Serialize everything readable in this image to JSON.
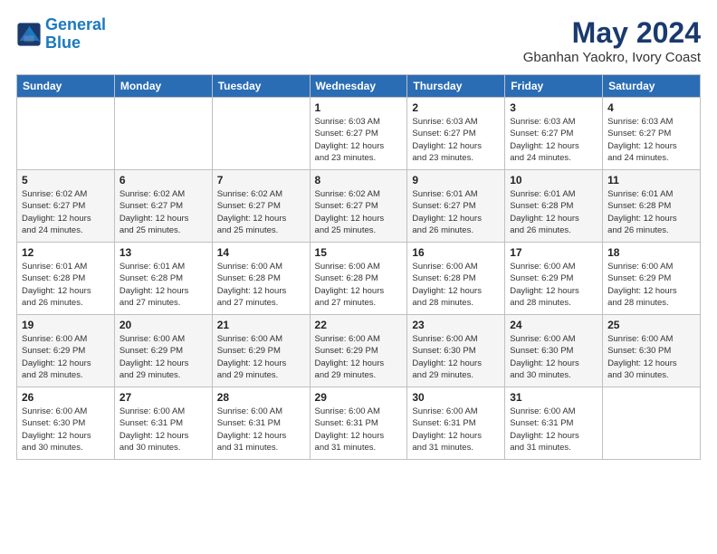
{
  "logo": {
    "line1": "General",
    "line2": "Blue"
  },
  "title": "May 2024",
  "subtitle": "Gbanhan Yaokro, Ivory Coast",
  "weekdays": [
    "Sunday",
    "Monday",
    "Tuesday",
    "Wednesday",
    "Thursday",
    "Friday",
    "Saturday"
  ],
  "weeks": [
    [
      {
        "day": "",
        "info": ""
      },
      {
        "day": "",
        "info": ""
      },
      {
        "day": "",
        "info": ""
      },
      {
        "day": "1",
        "info": "Sunrise: 6:03 AM\nSunset: 6:27 PM\nDaylight: 12 hours\nand 23 minutes."
      },
      {
        "day": "2",
        "info": "Sunrise: 6:03 AM\nSunset: 6:27 PM\nDaylight: 12 hours\nand 23 minutes."
      },
      {
        "day": "3",
        "info": "Sunrise: 6:03 AM\nSunset: 6:27 PM\nDaylight: 12 hours\nand 24 minutes."
      },
      {
        "day": "4",
        "info": "Sunrise: 6:03 AM\nSunset: 6:27 PM\nDaylight: 12 hours\nand 24 minutes."
      }
    ],
    [
      {
        "day": "5",
        "info": "Sunrise: 6:02 AM\nSunset: 6:27 PM\nDaylight: 12 hours\nand 24 minutes."
      },
      {
        "day": "6",
        "info": "Sunrise: 6:02 AM\nSunset: 6:27 PM\nDaylight: 12 hours\nand 25 minutes."
      },
      {
        "day": "7",
        "info": "Sunrise: 6:02 AM\nSunset: 6:27 PM\nDaylight: 12 hours\nand 25 minutes."
      },
      {
        "day": "8",
        "info": "Sunrise: 6:02 AM\nSunset: 6:27 PM\nDaylight: 12 hours\nand 25 minutes."
      },
      {
        "day": "9",
        "info": "Sunrise: 6:01 AM\nSunset: 6:27 PM\nDaylight: 12 hours\nand 26 minutes."
      },
      {
        "day": "10",
        "info": "Sunrise: 6:01 AM\nSunset: 6:28 PM\nDaylight: 12 hours\nand 26 minutes."
      },
      {
        "day": "11",
        "info": "Sunrise: 6:01 AM\nSunset: 6:28 PM\nDaylight: 12 hours\nand 26 minutes."
      }
    ],
    [
      {
        "day": "12",
        "info": "Sunrise: 6:01 AM\nSunset: 6:28 PM\nDaylight: 12 hours\nand 26 minutes."
      },
      {
        "day": "13",
        "info": "Sunrise: 6:01 AM\nSunset: 6:28 PM\nDaylight: 12 hours\nand 27 minutes."
      },
      {
        "day": "14",
        "info": "Sunrise: 6:00 AM\nSunset: 6:28 PM\nDaylight: 12 hours\nand 27 minutes."
      },
      {
        "day": "15",
        "info": "Sunrise: 6:00 AM\nSunset: 6:28 PM\nDaylight: 12 hours\nand 27 minutes."
      },
      {
        "day": "16",
        "info": "Sunrise: 6:00 AM\nSunset: 6:28 PM\nDaylight: 12 hours\nand 28 minutes."
      },
      {
        "day": "17",
        "info": "Sunrise: 6:00 AM\nSunset: 6:29 PM\nDaylight: 12 hours\nand 28 minutes."
      },
      {
        "day": "18",
        "info": "Sunrise: 6:00 AM\nSunset: 6:29 PM\nDaylight: 12 hours\nand 28 minutes."
      }
    ],
    [
      {
        "day": "19",
        "info": "Sunrise: 6:00 AM\nSunset: 6:29 PM\nDaylight: 12 hours\nand 28 minutes."
      },
      {
        "day": "20",
        "info": "Sunrise: 6:00 AM\nSunset: 6:29 PM\nDaylight: 12 hours\nand 29 minutes."
      },
      {
        "day": "21",
        "info": "Sunrise: 6:00 AM\nSunset: 6:29 PM\nDaylight: 12 hours\nand 29 minutes."
      },
      {
        "day": "22",
        "info": "Sunrise: 6:00 AM\nSunset: 6:29 PM\nDaylight: 12 hours\nand 29 minutes."
      },
      {
        "day": "23",
        "info": "Sunrise: 6:00 AM\nSunset: 6:30 PM\nDaylight: 12 hours\nand 29 minutes."
      },
      {
        "day": "24",
        "info": "Sunrise: 6:00 AM\nSunset: 6:30 PM\nDaylight: 12 hours\nand 30 minutes."
      },
      {
        "day": "25",
        "info": "Sunrise: 6:00 AM\nSunset: 6:30 PM\nDaylight: 12 hours\nand 30 minutes."
      }
    ],
    [
      {
        "day": "26",
        "info": "Sunrise: 6:00 AM\nSunset: 6:30 PM\nDaylight: 12 hours\nand 30 minutes."
      },
      {
        "day": "27",
        "info": "Sunrise: 6:00 AM\nSunset: 6:31 PM\nDaylight: 12 hours\nand 30 minutes."
      },
      {
        "day": "28",
        "info": "Sunrise: 6:00 AM\nSunset: 6:31 PM\nDaylight: 12 hours\nand 31 minutes."
      },
      {
        "day": "29",
        "info": "Sunrise: 6:00 AM\nSunset: 6:31 PM\nDaylight: 12 hours\nand 31 minutes."
      },
      {
        "day": "30",
        "info": "Sunrise: 6:00 AM\nSunset: 6:31 PM\nDaylight: 12 hours\nand 31 minutes."
      },
      {
        "day": "31",
        "info": "Sunrise: 6:00 AM\nSunset: 6:31 PM\nDaylight: 12 hours\nand 31 minutes."
      },
      {
        "day": "",
        "info": ""
      }
    ]
  ]
}
